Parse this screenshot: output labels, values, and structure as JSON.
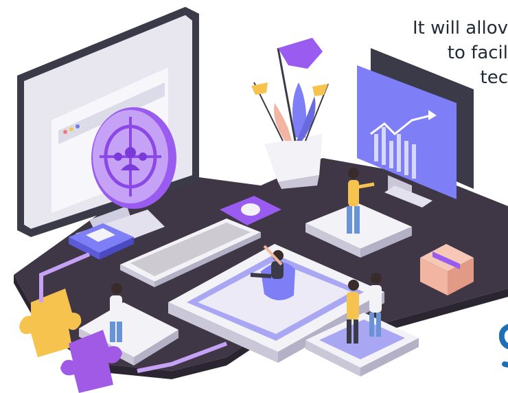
{
  "caption": {
    "line1": "It will allov",
    "line2": "to facil",
    "line3": "tec"
  },
  "colors": {
    "platform": "#3f3646",
    "platform_edge": "#2b2431",
    "tile_top": "#f3f2f7",
    "tile_side": "#c9c7d8",
    "purple": "#9a5cf0",
    "purple_light": "#c6a2f6",
    "violet_screen": "#7e7ef6",
    "lavender": "#a9a7f3",
    "monitor_dark": "#3b3a48",
    "puzzle_yellow": "#f6c34f",
    "puzzle_purple": "#a05ae6",
    "box_pink": "#f2b5a2",
    "accent_blue": "#1f6fb7"
  },
  "icons": {
    "target": "users-target-icon",
    "chart": "trend-chart-icon",
    "flag": "flag-icon"
  }
}
